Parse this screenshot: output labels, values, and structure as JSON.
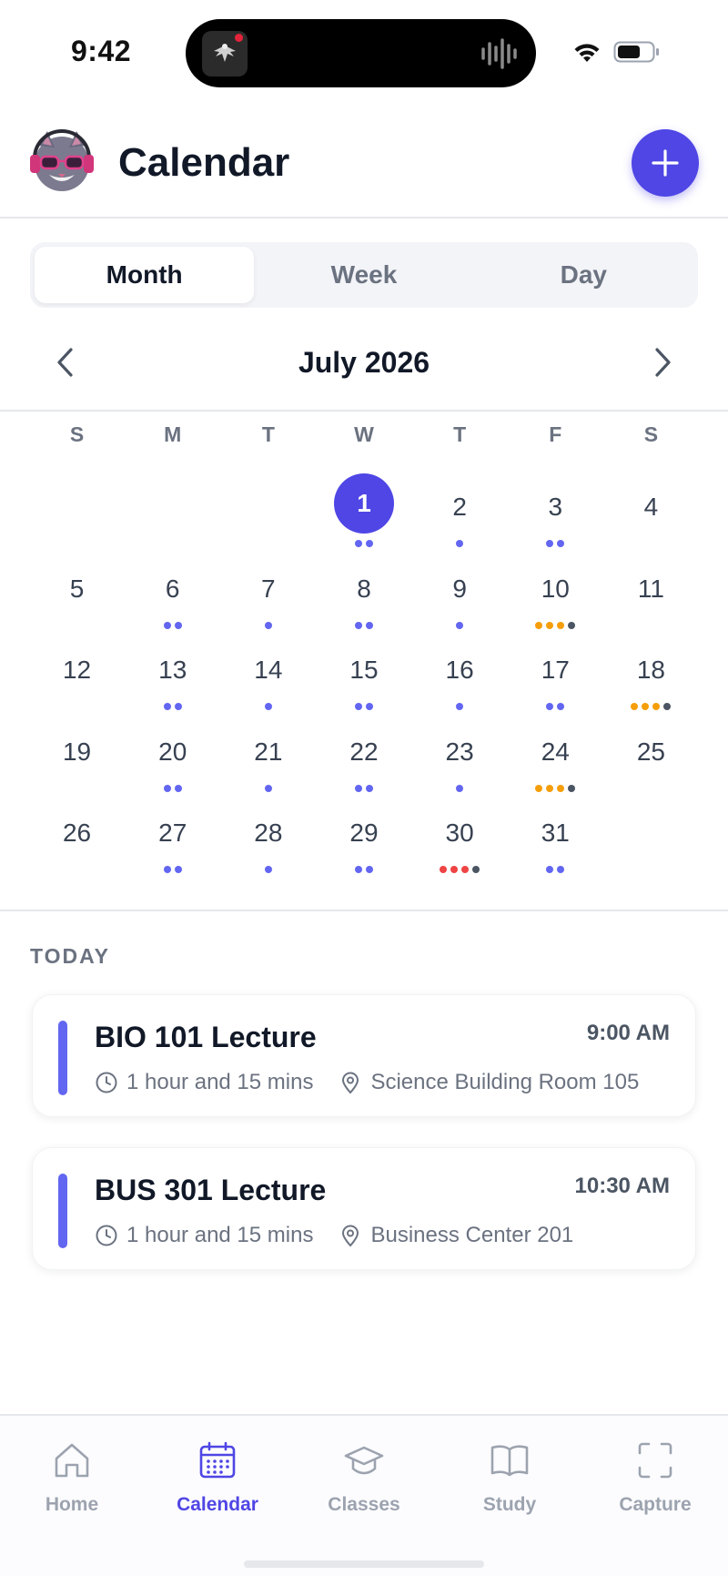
{
  "status_bar": {
    "time": "9:42"
  },
  "header": {
    "title": "Calendar",
    "add_icon": "plus-icon"
  },
  "view_tabs": [
    {
      "label": "Month",
      "active": true
    },
    {
      "label": "Week",
      "active": false
    },
    {
      "label": "Day",
      "active": false
    }
  ],
  "month_nav": {
    "label": "July 2026"
  },
  "weekdays": [
    "S",
    "M",
    "T",
    "W",
    "T",
    "F",
    "S"
  ],
  "colors": {
    "accent": "#4f46e5",
    "dot_purple": "#6366f1",
    "dot_orange": "#f59e0b",
    "dot_red": "#ef4444",
    "dot_gray": "#4b5563"
  },
  "calendar": {
    "first_weekday": 3,
    "today": 1,
    "days": [
      {
        "day": "1",
        "dots": [
          "purple",
          "purple"
        ]
      },
      {
        "day": "2",
        "dots": [
          "purple"
        ]
      },
      {
        "day": "3",
        "dots": [
          "purple",
          "purple"
        ]
      },
      {
        "day": "4",
        "dots": []
      },
      {
        "day": "5",
        "dots": []
      },
      {
        "day": "6",
        "dots": [
          "purple",
          "purple"
        ]
      },
      {
        "day": "7",
        "dots": [
          "purple"
        ]
      },
      {
        "day": "8",
        "dots": [
          "purple",
          "purple"
        ]
      },
      {
        "day": "9",
        "dots": [
          "purple"
        ]
      },
      {
        "day": "10",
        "dots": [
          "orange",
          "orange",
          "orange",
          "gray"
        ]
      },
      {
        "day": "11",
        "dots": []
      },
      {
        "day": "12",
        "dots": []
      },
      {
        "day": "13",
        "dots": [
          "purple",
          "purple"
        ]
      },
      {
        "day": "14",
        "dots": [
          "purple"
        ]
      },
      {
        "day": "15",
        "dots": [
          "purple",
          "purple"
        ]
      },
      {
        "day": "16",
        "dots": [
          "purple"
        ]
      },
      {
        "day": "17",
        "dots": [
          "purple",
          "purple"
        ]
      },
      {
        "day": "18",
        "dots": [
          "orange",
          "orange",
          "orange",
          "gray"
        ]
      },
      {
        "day": "19",
        "dots": []
      },
      {
        "day": "20",
        "dots": [
          "purple",
          "purple"
        ]
      },
      {
        "day": "21",
        "dots": [
          "purple"
        ]
      },
      {
        "day": "22",
        "dots": [
          "purple",
          "purple"
        ]
      },
      {
        "day": "23",
        "dots": [
          "purple"
        ]
      },
      {
        "day": "24",
        "dots": [
          "orange",
          "orange",
          "orange",
          "gray"
        ]
      },
      {
        "day": "25",
        "dots": []
      },
      {
        "day": "26",
        "dots": []
      },
      {
        "day": "27",
        "dots": [
          "purple",
          "purple"
        ]
      },
      {
        "day": "28",
        "dots": [
          "purple"
        ]
      },
      {
        "day": "29",
        "dots": [
          "purple",
          "purple"
        ]
      },
      {
        "day": "30",
        "dots": [
          "red",
          "red",
          "red",
          "gray"
        ]
      },
      {
        "day": "31",
        "dots": [
          "purple",
          "purple"
        ]
      }
    ]
  },
  "today_section": {
    "title": "TODAY",
    "events": [
      {
        "title": "BIO 101 Lecture",
        "time": "9:00 AM",
        "duration": "1 hour and 15 mins",
        "location": "Science Building Room 105"
      },
      {
        "title": "BUS 301 Lecture",
        "time": "10:30 AM",
        "duration": "1 hour and 15 mins",
        "location": "Business Center 201"
      }
    ]
  },
  "tab_bar": [
    {
      "label": "Home",
      "icon": "home-icon",
      "active": false
    },
    {
      "label": "Calendar",
      "icon": "calendar-icon",
      "active": true
    },
    {
      "label": "Classes",
      "icon": "graduation-cap-icon",
      "active": false
    },
    {
      "label": "Study",
      "icon": "book-icon",
      "active": false
    },
    {
      "label": "Capture",
      "icon": "scan-frame-icon",
      "active": false
    }
  ]
}
